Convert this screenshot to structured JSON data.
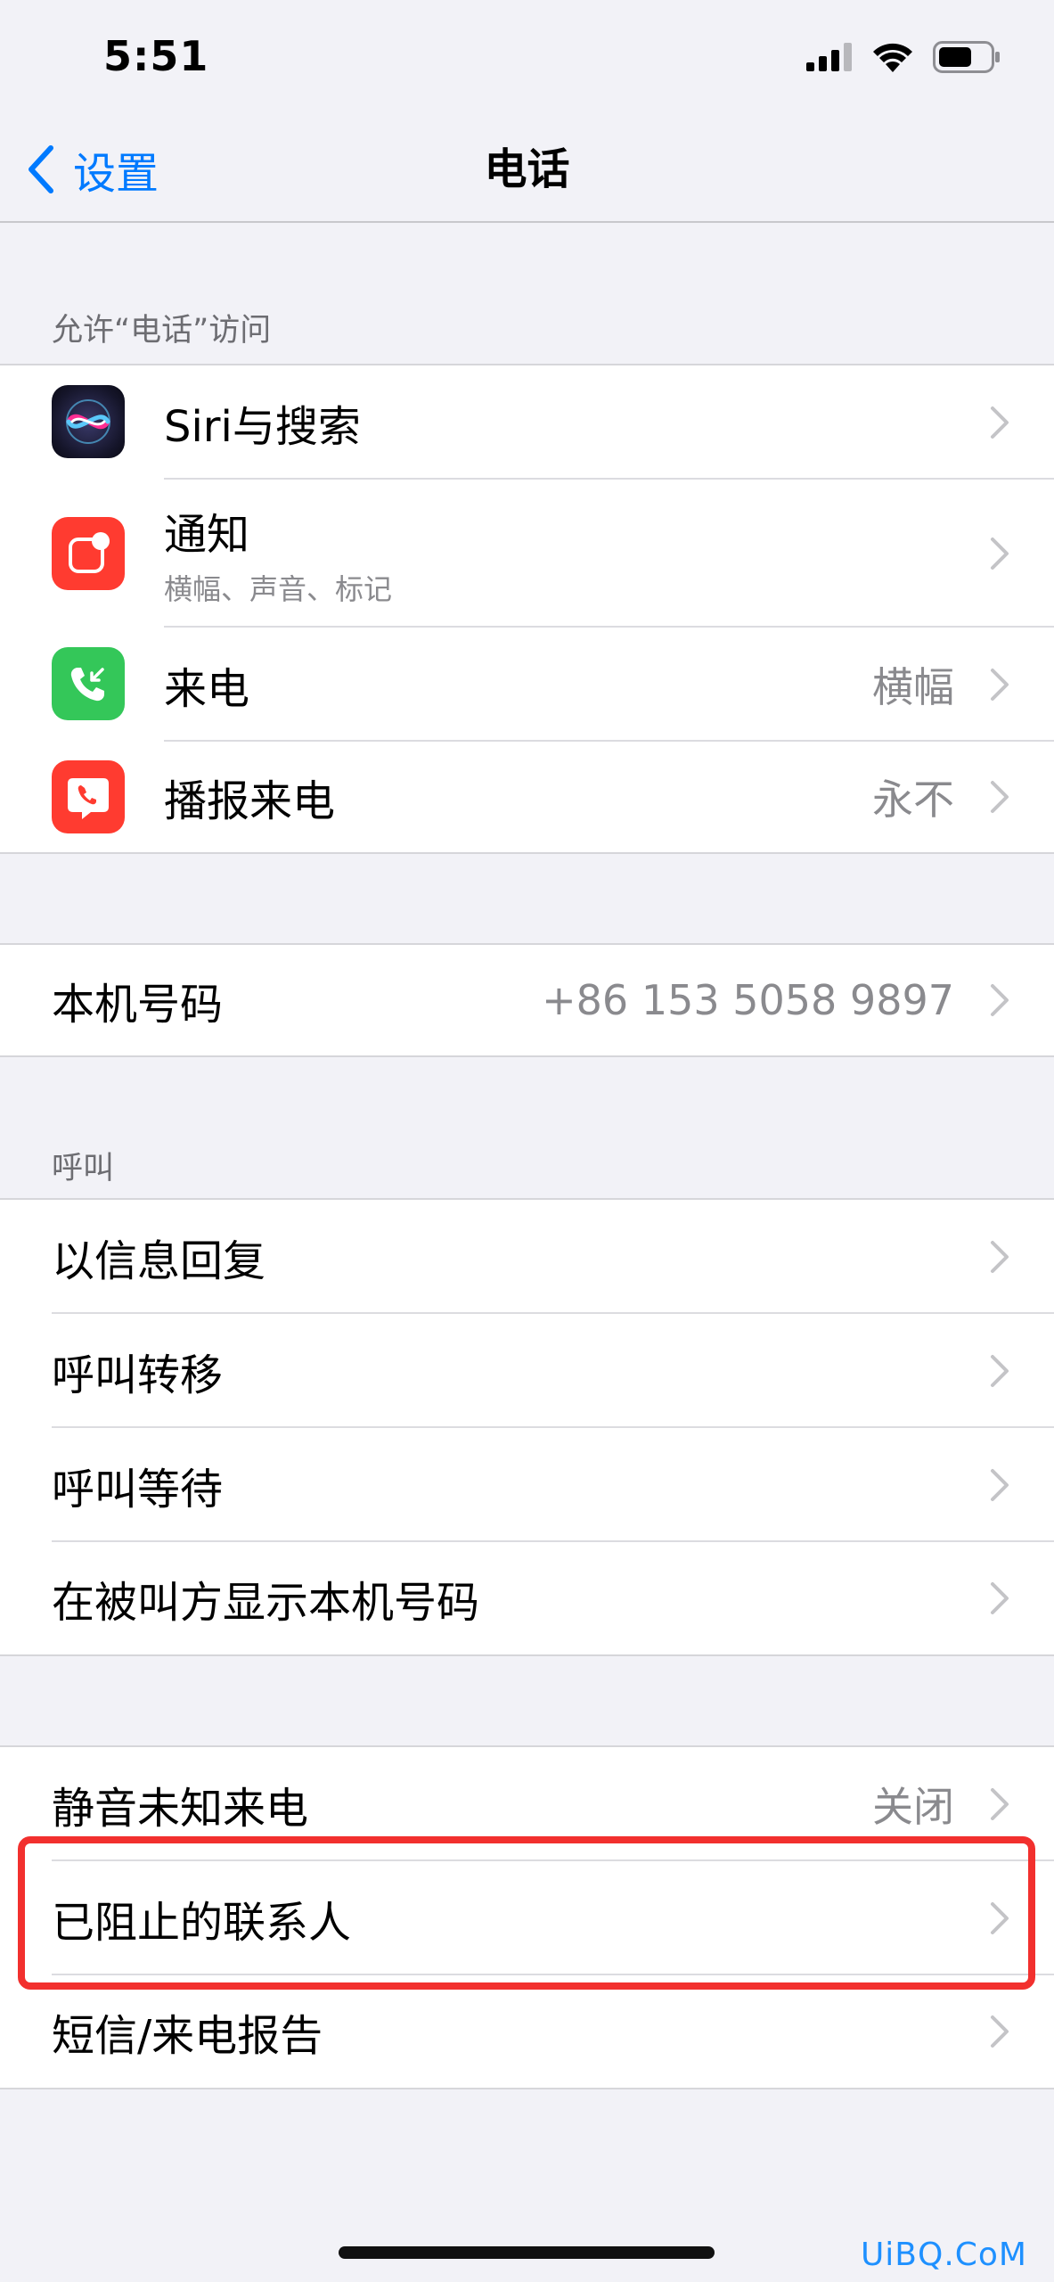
{
  "status_bar": {
    "time": "5:51"
  },
  "nav": {
    "back_label": "设置",
    "title": "电话"
  },
  "sections": {
    "allow_access_header": "允许“电话”访问",
    "calls_header": "呼叫"
  },
  "access_rows": [
    {
      "label": "Siri与搜索",
      "icon": "siri-icon"
    },
    {
      "label": "通知",
      "sublabel": "横幅、声音、标记",
      "icon": "notification-icon"
    },
    {
      "label": "来电",
      "value": "横幅",
      "icon": "incoming-call-icon"
    },
    {
      "label": "播报来电",
      "value": "永不",
      "icon": "announce-call-icon"
    }
  ],
  "my_number": {
    "label": "本机号码",
    "value": "+86 153 5058 9897"
  },
  "call_rows": [
    {
      "label": "以信息回复"
    },
    {
      "label": "呼叫转移"
    },
    {
      "label": "呼叫等待"
    },
    {
      "label": "在被叫方显示本机号码"
    }
  ],
  "block_rows": [
    {
      "label": "静音未知来电",
      "value": "关闭"
    },
    {
      "label": "已阻止的联系人"
    },
    {
      "label": "短信/来电报告"
    }
  ],
  "watermark": "UiBQ.CoM",
  "colors": {
    "accent": "#007aff",
    "background": "#f2f2f7",
    "highlight": "#f2302e"
  }
}
